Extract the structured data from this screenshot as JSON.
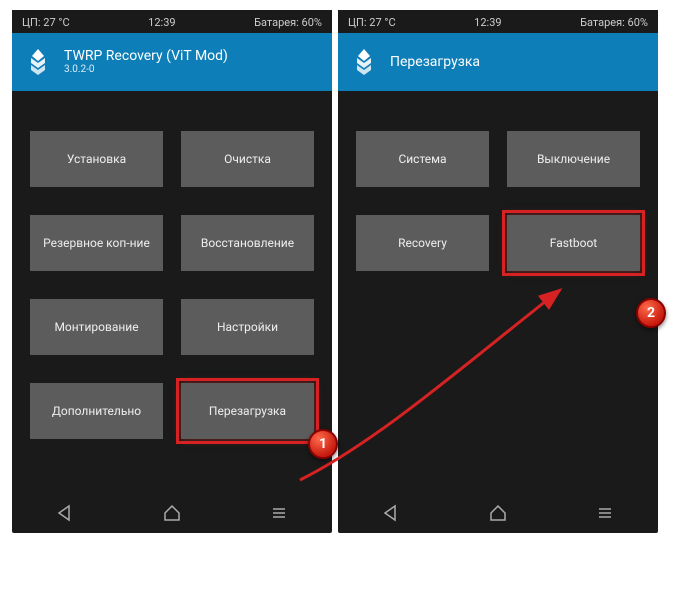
{
  "left": {
    "status": {
      "temp": "ЦП: 27 °C",
      "time": "12:39",
      "battery": "Батарея: 60%"
    },
    "header": {
      "title": "TWRP Recovery (ViT Mod)",
      "version": "3.0.2-0"
    },
    "buttons": [
      "Установка",
      "Очистка",
      "Резервное коп-ние",
      "Восстановление",
      "Монтирование",
      "Настройки",
      "Дополнительно",
      "Перезагрузка"
    ]
  },
  "right": {
    "status": {
      "temp": "ЦП: 27 °C",
      "time": "12:39",
      "battery": "Батарея: 60%"
    },
    "header": {
      "title": "Перезагрузка"
    },
    "buttons": [
      "Система",
      "Выключение",
      "Recovery",
      "Fastboot"
    ]
  },
  "badges": {
    "one": "1",
    "two": "2"
  }
}
